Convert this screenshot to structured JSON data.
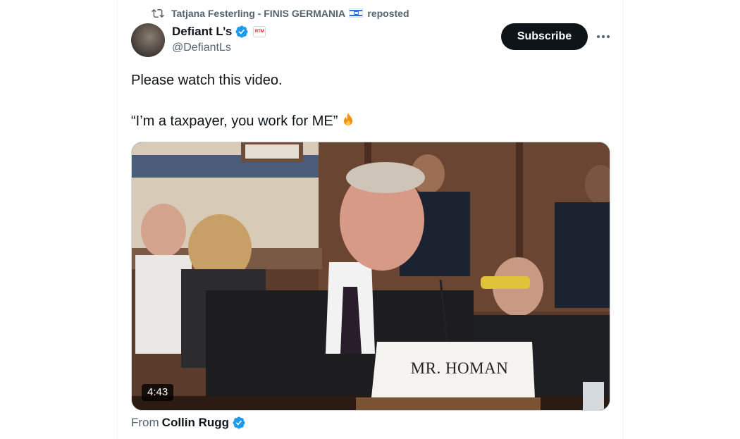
{
  "repost": {
    "icon": "repost-icon",
    "user": "Tatjana Festerling - FINIS GERMANIA",
    "flag": "israel-flag-icon",
    "suffix": "reposted"
  },
  "author": {
    "name": "Defiant L’s",
    "handle": "@DefiantLs",
    "verified_color": "#1d9bf0",
    "affiliate_badge": "RTM"
  },
  "actions": {
    "subscribe_label": "Subscribe",
    "more_icon": "more-icon"
  },
  "tweet": {
    "line1": "Please watch this video.",
    "line2": "“I’m a taxpayer, you work for ME”",
    "emoji": "fire-icon"
  },
  "media": {
    "duration": "4:43",
    "placard": "MR. HOMAN"
  },
  "source": {
    "prefix": "From",
    "name": "Collin Rugg",
    "verified_color": "#1d9bf0"
  },
  "colors": {
    "primary_text": "#0f1419",
    "secondary_text": "#536471",
    "subscribe_bg": "#0f1419",
    "verified": "#1d9bf0"
  }
}
